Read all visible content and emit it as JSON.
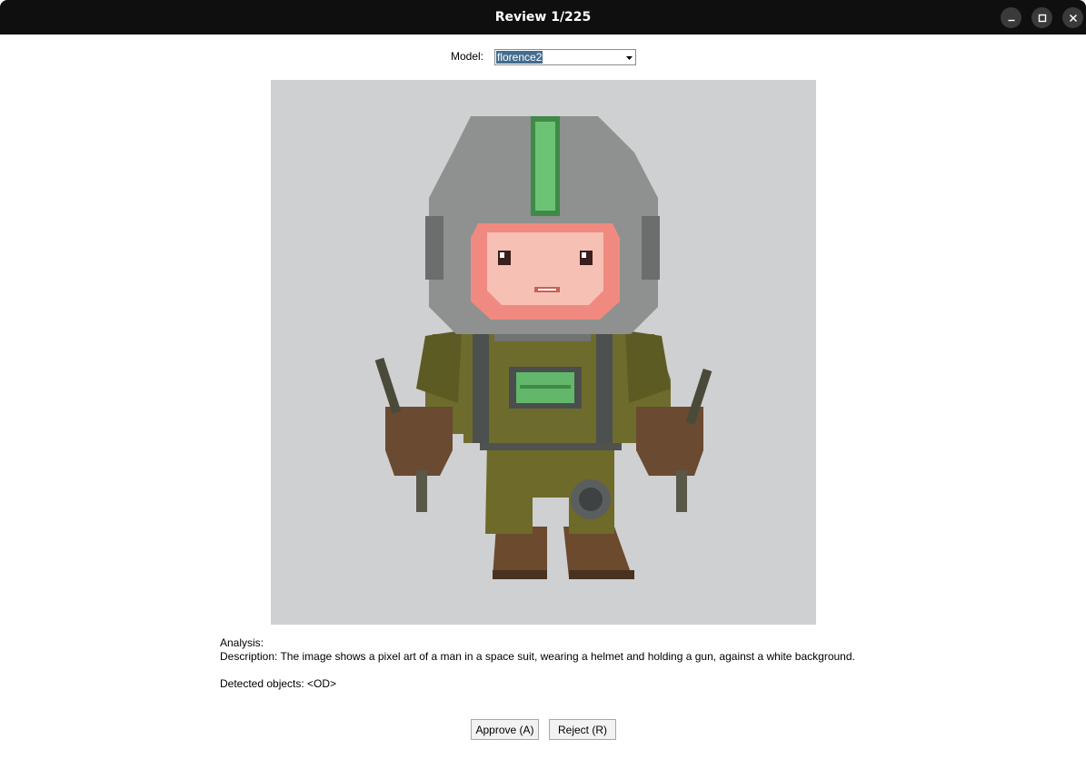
{
  "window": {
    "title": "Review 1/225",
    "controls": [
      "minimize-icon",
      "maximize-icon",
      "close-icon"
    ]
  },
  "model": {
    "label": "Model:",
    "selected": "florence2"
  },
  "preview": {
    "background_color": "#cfd0d1"
  },
  "analysis": {
    "heading": "Analysis:",
    "description": "Description: The image shows a pixel art of a man in a space suit, wearing a helmet and holding a gun, against a white background.",
    "detected": "Detected objects: <OD>"
  },
  "actions": {
    "approve_label": "Approve (A)",
    "reject_label": "Reject (R)"
  }
}
